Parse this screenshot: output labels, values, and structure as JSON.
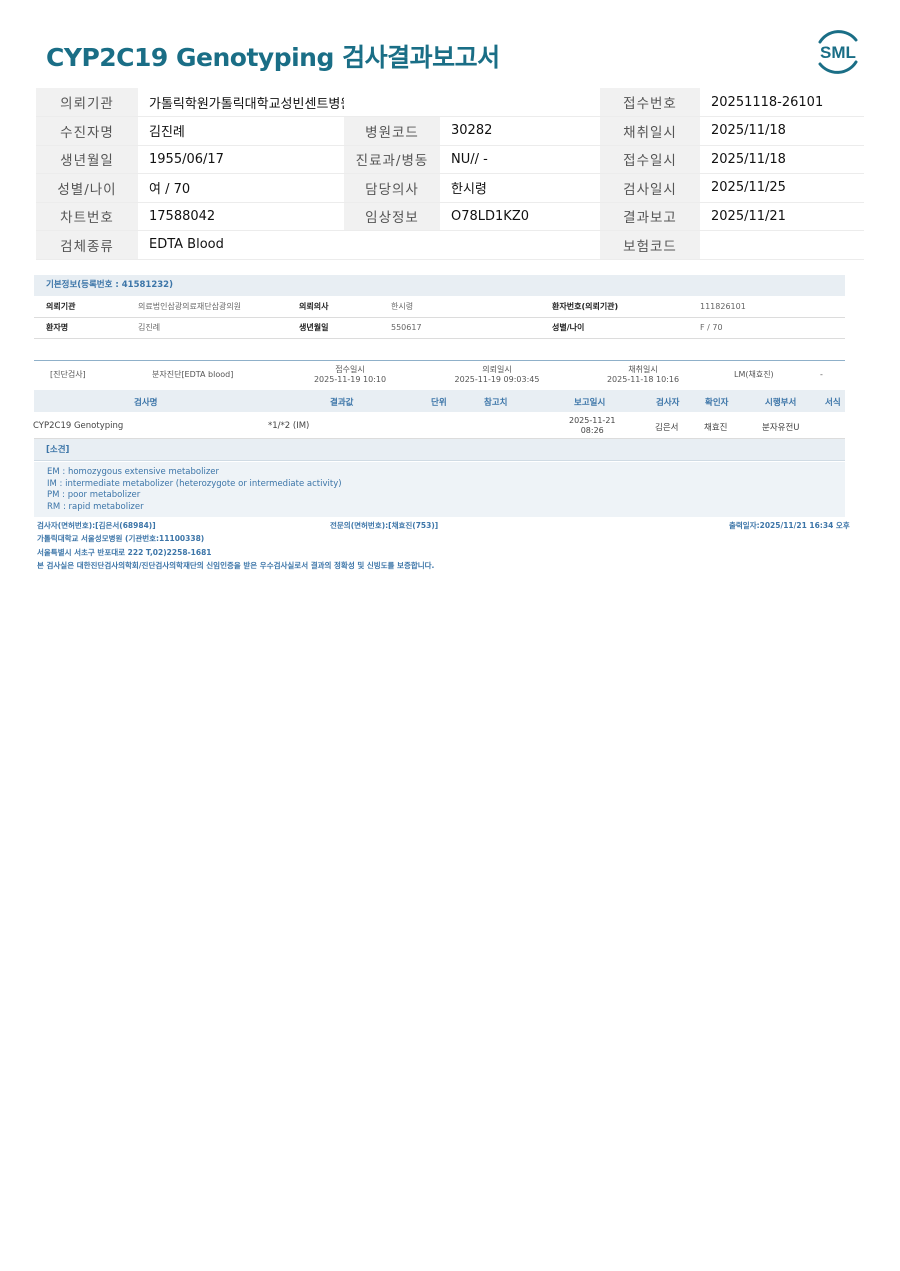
{
  "report": {
    "title": "CYP2C19 Genotyping 검사결과보고서",
    "logo_text": "SML"
  },
  "header": {
    "rows": [
      [
        "의뢰기관",
        "가톨릭학원가톨릭대학교성빈센트병원",
        "",
        "",
        "접수번호",
        "20251118-26101"
      ],
      [
        "수진자명",
        "김진례",
        "병원코드",
        "30282",
        "채취일시",
        "2025/11/18"
      ],
      [
        "생년월일",
        "1955/06/17",
        "진료과/병동",
        "NU// -",
        "접수일시",
        "2025/11/18"
      ],
      [
        "성별/나이",
        "여 / 70",
        "담당의사",
        "한시령",
        "검사일시",
        "2025/11/25"
      ],
      [
        "차트번호",
        "17588042",
        "임상정보",
        "O78LD1KZ0",
        "결과보고",
        "2025/11/21"
      ],
      [
        "검체종류",
        "EDTA Blood",
        "",
        "",
        "보험코드",
        ""
      ]
    ]
  },
  "basic_info": {
    "heading": "기본정보(등록번호 : 41581232)",
    "rows": [
      [
        "의뢰기관",
        "의료법인삼광의료재단삼광의원",
        "의뢰의사",
        "한시령",
        "환자번호(의뢰기관)",
        "111826101"
      ],
      [
        "환자명",
        "김진례",
        "생년월일",
        "550617",
        "성별/나이",
        "F / 70"
      ]
    ]
  },
  "diagnosis": {
    "category": "[진단검사]",
    "specimen": "분자진단[EDTA blood]",
    "received_label": "접수일시",
    "received": "2025-11-19 10:10",
    "requested_label": "의뢰일시",
    "requested": "2025-11-19 09:03:45",
    "collected_label": "채취일시",
    "collected": "2025-11-18 10:16",
    "lm": "LM(채효진)",
    "dash": "-"
  },
  "results": {
    "columns": [
      "검사명",
      "결과값",
      "단위",
      "참고치",
      "보고일시",
      "검사자",
      "확인자",
      "시행부서",
      "서식"
    ],
    "row": {
      "test": "CYP2C19 Genotyping",
      "value": "*1/*2 (IM)",
      "report_date": "2025-11-21",
      "report_time": "08:26",
      "tester": "김은서",
      "confirmer": "채효진",
      "department": "분자유전U"
    }
  },
  "remarks": {
    "heading": "[소견]",
    "lines": [
      "EM : homozygous extensive metabolizer",
      "IM  : intermediate metabolizer (heterozygote or intermediate activity)",
      "PM : poor metabolizer",
      "RM : rapid metabolizer"
    ]
  },
  "footer": {
    "tester": "검사자(면허번호):[김은서(68984)]",
    "specialist": "전문의(면허번호):[채효진(753)]",
    "printed": "출력일자:2025/11/21 16:34 오후",
    "institution": "가톨릭대학교 서울성모병원 (기관번호:11100338)",
    "address": "서울특별시 서초구 반포대로 222 T,02)2258-1681",
    "certification": "본 검사실은 대한진단검사의학회/진단검사의학재단의 신임인증을 받은 우수검사실로서 결과의 정확성 및 신빙도를 보증합니다."
  }
}
